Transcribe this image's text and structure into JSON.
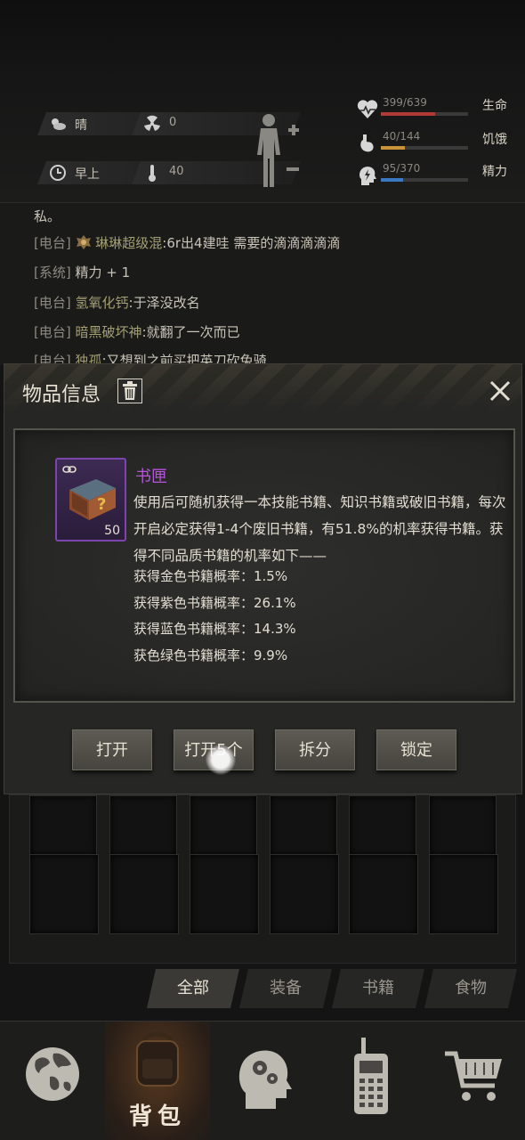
{
  "status": {
    "weather": "晴",
    "radiation": "0",
    "time_of_day": "早上",
    "temperature": "40",
    "vitals": [
      {
        "value": "399/639",
        "label": "生命",
        "ratio": 0.624,
        "color": "#b03a36"
      },
      {
        "value": "40/144",
        "label": "饥饿",
        "ratio": 0.278,
        "color": "#c9933a"
      },
      {
        "value": "95/370",
        "label": "精力",
        "ratio": 0.257,
        "color": "#3a78c4"
      }
    ]
  },
  "chat": {
    "line0": "私。",
    "line1": {
      "tag": "[电台]",
      "name": "琳琳超级混",
      "msg": ":6r出4建哇 需要的滴滴滴滴滴"
    },
    "line2": {
      "tag": "[系统]",
      "msg": "精力 + 1"
    },
    "line3": {
      "tag": "[电台]",
      "name": "氢氧化钙",
      "msg": ":于泽没改名"
    },
    "line4": {
      "tag": "[电台]",
      "name": "暗黑破坏神",
      "msg": ":就翻了一次而已"
    },
    "line5": {
      "tag": "[电台]",
      "name": "独孤",
      "msg": ":又想到之前买把英刀砍兔骑"
    }
  },
  "dialog": {
    "title": "物品信息",
    "item": {
      "name": "书匣",
      "count": "50",
      "rarity_color": "#b456d9",
      "description": "使用后可随机获得一本技能书籍、知识书籍或破旧书籍，每次开启必定获得1-4个废旧书籍，有51.8%的机率获得书籍。获得不同品质书籍的机率如下——",
      "rates": [
        "获得金色书籍概率：1.5%",
        "获得紫色书籍概率：26.1%",
        "获得蓝色书籍概率：14.3%",
        "获色绿色书籍概率：9.9%"
      ]
    },
    "buttons": {
      "open": "打开",
      "open5": "打开5个",
      "split": "拆分",
      "lock": "锁定"
    }
  },
  "filters": {
    "all": "全部",
    "equipment": "装备",
    "books": "书籍",
    "food": "食物"
  },
  "nav": {
    "bag": "背包"
  }
}
